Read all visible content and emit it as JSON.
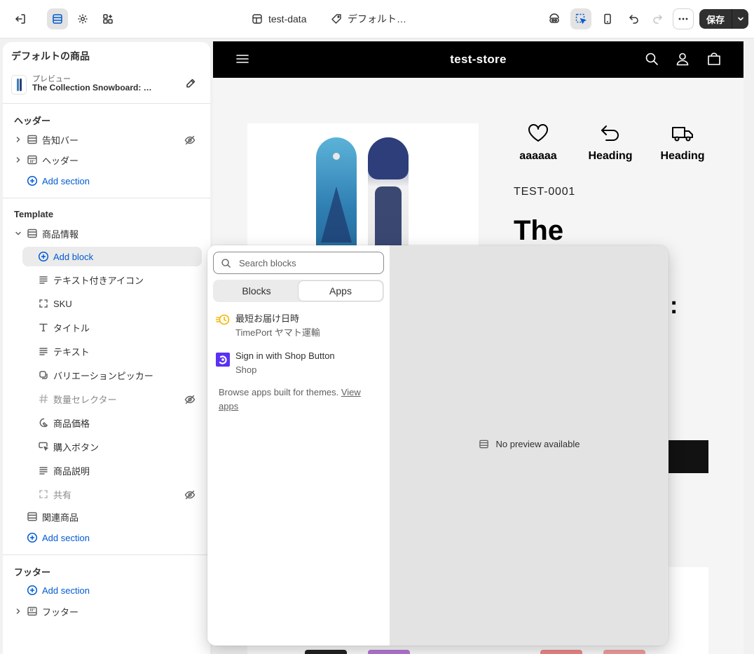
{
  "topbar": {
    "theme_name": "test-data",
    "template_name": "デフォルト…",
    "save_label": "保存"
  },
  "sidebar": {
    "title": "デフォルトの商品",
    "preview": {
      "label": "プレビュー",
      "product": "The Collection Snowboard: …"
    },
    "header_section": {
      "heading": "ヘッダー",
      "items": [
        {
          "label": "告知バー"
        },
        {
          "label": "ヘッダー"
        }
      ],
      "add_label": "Add section"
    },
    "template_section": {
      "heading": "Template",
      "parent": "商品情報",
      "add_block": "Add block",
      "blocks": [
        {
          "label": "テキスト付きアイコン"
        },
        {
          "label": "SKU"
        },
        {
          "label": "タイトル"
        },
        {
          "label": "テキスト"
        },
        {
          "label": "バリエーションピッカー"
        },
        {
          "label": "数量セレクター"
        },
        {
          "label": "商品価格"
        },
        {
          "label": "購入ボタン"
        },
        {
          "label": "商品説明"
        },
        {
          "label": "共有"
        }
      ],
      "related": "関連商品",
      "add_label": "Add section"
    },
    "footer_section": {
      "heading": "フッター",
      "add_label": "Add section",
      "items": [
        {
          "label": "フッター"
        }
      ]
    }
  },
  "preview": {
    "store_name": "test-store",
    "features": [
      {
        "icon": "heart-icon",
        "label": "aaaaaa"
      },
      {
        "icon": "return-arrow-icon",
        "label": "Heading"
      },
      {
        "icon": "truck-icon",
        "label": "Heading"
      }
    ],
    "sku": "TEST-0001",
    "title_visible": "The",
    "title_fragment": ":"
  },
  "picker": {
    "search_placeholder": "Search blocks",
    "tabs": [
      {
        "label": "Blocks",
        "selected": false
      },
      {
        "label": "Apps",
        "selected": true
      }
    ],
    "apps": [
      {
        "name": "最短お届け日時",
        "developer": "TimePort ヤマト運輸"
      },
      {
        "name": "Sign in with Shop Button",
        "developer": "Shop"
      }
    ],
    "browse_text": "Browse apps built for themes. ",
    "browse_link": "View apps",
    "no_preview": "No preview available"
  },
  "colors": {
    "accent": "#005bd3",
    "text": "#303030",
    "muted": "#616161",
    "store_header": "#000000",
    "shop_brand": "#5a31f4",
    "timeport": "#f5b500"
  }
}
